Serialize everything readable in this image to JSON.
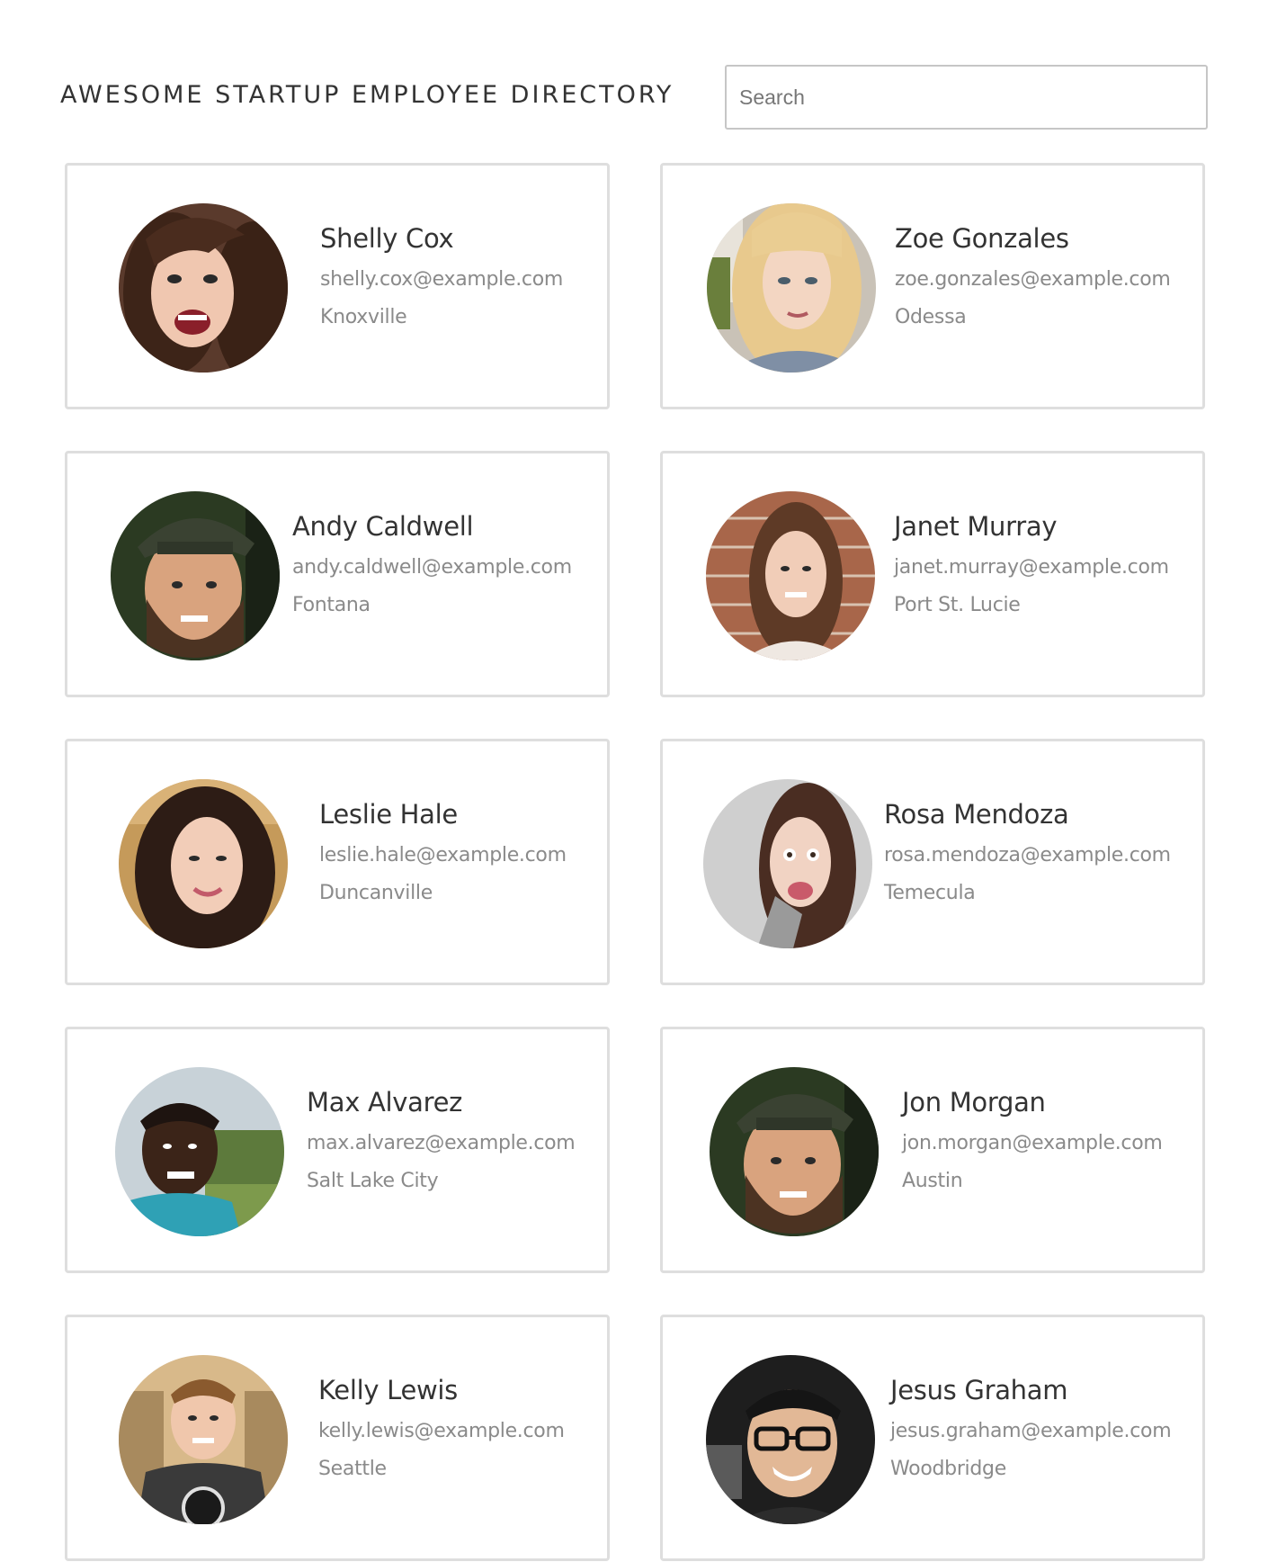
{
  "header": {
    "title": "AWESOME STARTUP EMPLOYEE DIRECTORY",
    "search_placeholder": "Search"
  },
  "employees": [
    {
      "name": "Shelly Cox",
      "email": "shelly.cox@example.com",
      "city": "Knoxville"
    },
    {
      "name": "Zoe Gonzales",
      "email": "zoe.gonzales@example.com",
      "city": "Odessa"
    },
    {
      "name": "Andy Caldwell",
      "email": "andy.caldwell@example.com",
      "city": "Fontana"
    },
    {
      "name": "Janet Murray",
      "email": "janet.murray@example.com",
      "city": "Port St. Lucie"
    },
    {
      "name": "Leslie Hale",
      "email": "leslie.hale@example.com",
      "city": "Duncanville"
    },
    {
      "name": "Rosa Mendoza",
      "email": "rosa.mendoza@example.com",
      "city": "Temecula"
    },
    {
      "name": "Max Alvarez",
      "email": "max.alvarez@example.com",
      "city": "Salt Lake City"
    },
    {
      "name": "Jon Morgan",
      "email": "jon.morgan@example.com",
      "city": "Austin"
    },
    {
      "name": "Kelly Lewis",
      "email": "kelly.lewis@example.com",
      "city": "Seattle"
    },
    {
      "name": "Jesus Graham",
      "email": "jesus.graham@example.com",
      "city": "Woodbridge"
    }
  ]
}
